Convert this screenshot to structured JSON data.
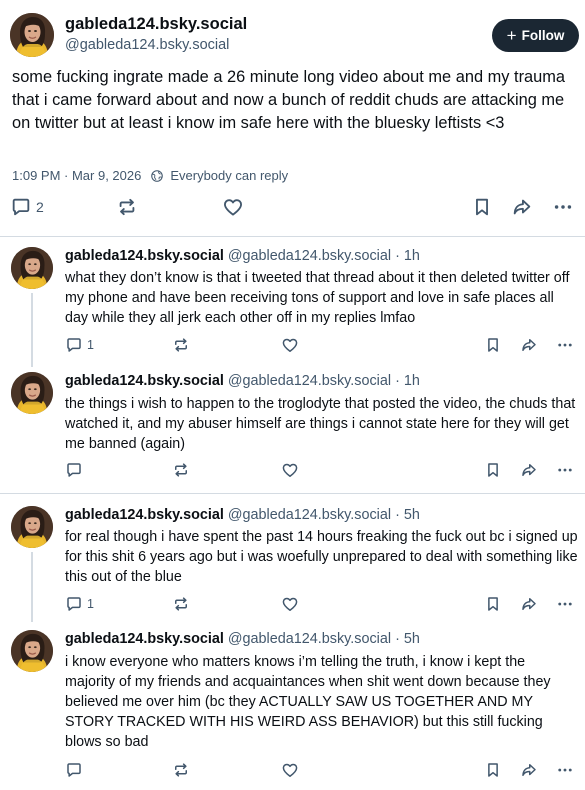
{
  "post": {
    "display_name": "gableda124.bsky.social",
    "handle": "@gableda124.bsky.social",
    "follow_label": "Follow",
    "text": "some fucking ingrate made a 26 minute long video about me and my trauma that i came forward about and now a bunch of reddit chuds are attacking me on twitter but at least i know im safe here with the bluesky leftists <3",
    "timestamp": "1:09 PM · Mar 9, 2026",
    "reply_setting": "Everybody can reply",
    "reply_count": "2",
    "repost_count": "",
    "like_count": ""
  },
  "replies": [
    {
      "display_name": "gableda124.bsky.social",
      "handle": "@gableda124.bsky.social",
      "age": "· 1h",
      "text": "what they don’t know is that i tweeted that thread about it then deleted twitter off my phone and have been receiving tons of support and love in safe places all day while they all jerk each other off in my replies lmfao",
      "reply_count": "1"
    },
    {
      "display_name": "gableda124.bsky.social",
      "handle": "@gableda124.bsky.social",
      "age": "· 1h",
      "text": "the things i wish to happen to the troglodyte that posted the video, the chuds that watched it, and my abuser himself are things i cannot state here for they will get me banned (again)",
      "reply_count": ""
    },
    {
      "display_name": "gableda124.bsky.social",
      "handle": "@gableda124.bsky.social",
      "age": "· 5h",
      "text": "for real though i have spent the past 14 hours freaking the fuck out bc i signed up for this shit 6 years ago but i was woefully unprepared to deal with something like this out of the blue",
      "reply_count": "1"
    },
    {
      "display_name": "gableda124.bsky.social",
      "handle": "@gableda124.bsky.social",
      "age": "· 5h",
      "text": "i know everyone who matters knows i’m telling the truth, i know i kept the majority of my friends and acquaintances when shit went down because they believed me over him (bc they ACTUALLY SAW US TOGETHER AND MY STORY TRACKED WITH HIS WEIRD ASS BEHAVIOR) but this still fucking blows so bad",
      "reply_count": ""
    }
  ],
  "icons": {
    "reply": "reply-icon",
    "repost": "repost-icon",
    "like": "heart-icon",
    "bookmark": "bookmark-icon",
    "share": "share-icon",
    "more": "more-icon",
    "reply_setting": "globe-icon"
  },
  "colors": {
    "text_primary": "#0b0f14",
    "text_secondary": "#42576c",
    "follow_bg": "#1b2733",
    "divider": "#d4dbe2",
    "background": "#ffffff"
  }
}
